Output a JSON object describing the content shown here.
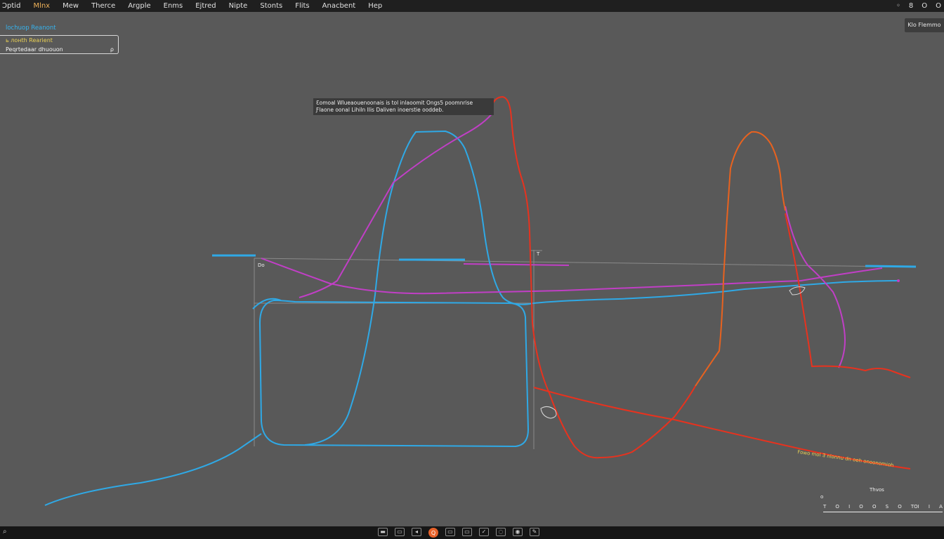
{
  "menubar": {
    "items": [
      {
        "label": "Ɔptid",
        "accent": false
      },
      {
        "label": "Mlnx",
        "accent": true
      },
      {
        "label": "Mew",
        "accent": false
      },
      {
        "label": "Therce",
        "accent": false
      },
      {
        "label": "Argple",
        "accent": false
      },
      {
        "label": "Enms",
        "accent": false
      },
      {
        "label": "Ejtred",
        "accent": false
      },
      {
        "label": "Nipte",
        "accent": false
      },
      {
        "label": "Stonts",
        "accent": false
      },
      {
        "label": "Flits",
        "accent": false
      },
      {
        "label": "Anacbent",
        "accent": false
      },
      {
        "label": "Hep",
        "accent": false
      }
    ],
    "window_controls": [
      "◦",
      "8",
      "O",
      "O"
    ]
  },
  "panel": {
    "title": "lochuop Reanont",
    "layer": {
      "line1": "ь лонth Rearient",
      "line2": "Peqrtedaar dhuouon",
      "glyph": "ρ"
    }
  },
  "corner_button": "Klo Flemmo",
  "tooltip": {
    "line1": "Ɛomoal Wlueaouenoonais is tol inlaoomit Ongs5 poomnrise",
    "line2": "Ƒlaone oonal Lihiln Ilis Daliven inoerstie ooddeb."
  },
  "ruler": {
    "label_a": "Do",
    "label_b": "T"
  },
  "annotation": "Fowo mol Ǝ nlonnu dn oeh onoonomioh",
  "scale": {
    "label": "Thvos",
    "glyph": "o",
    "ticks": [
      "T",
      "O",
      "I",
      "O",
      "O",
      "S",
      "O",
      "TOI",
      "I",
      "A"
    ]
  },
  "taskbar": {
    "start": "⌕",
    "icons": [
      "▬",
      "▭",
      "◂",
      "Q",
      "▭",
      "▭",
      "✓",
      "◌",
      "◉",
      "✎"
    ],
    "hot_index": 3
  },
  "colors": {
    "blue": "#2fa9e6",
    "magenta": "#c13fc6",
    "red": "#e8321e",
    "orange": "#e8621f",
    "menubar": "#1f1f1f",
    "background": "#595959"
  }
}
